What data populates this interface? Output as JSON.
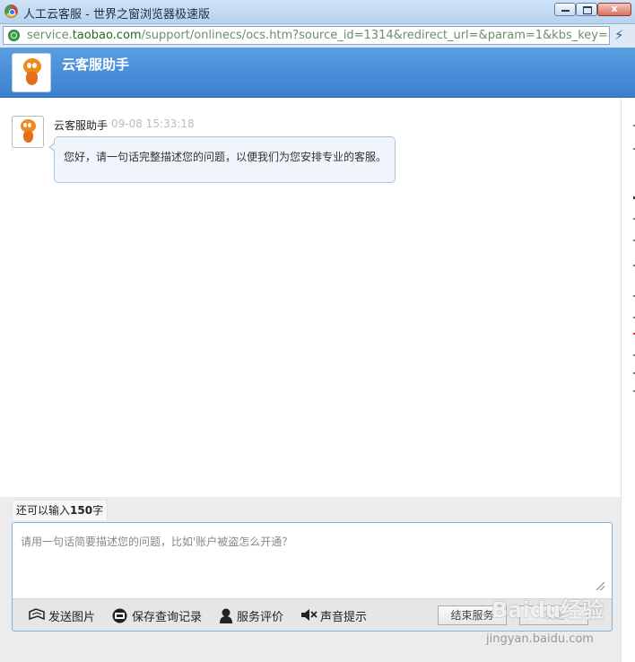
{
  "window": {
    "title": "人工云客服 - 世界之窗浏览器极速版",
    "close_label": "x"
  },
  "address_bar": {
    "url_prefix": "service.",
    "url_domain": "taobao.com",
    "url_rest": "/support/onlinecs/ocs.htm?source_id=1314&redirect_url=&param=1&kbs_key=&out_token=",
    "bolt_icon": "⚡"
  },
  "header": {
    "assistant_name": "云客服助手"
  },
  "conversation": {
    "messages": [
      {
        "sender": "云客服助手",
        "time": "09-08 15:33:18",
        "text": "您好，请一句话完整描述您的问题，以便我们为您安排专业的客服。"
      }
    ]
  },
  "composer": {
    "counter_prefix": "还可以输入",
    "counter_value": "150",
    "counter_suffix": "字",
    "placeholder": "请用一句话简要描述您的问题，比如'账户被盗怎么开通？",
    "tools": {
      "send_image": "发送图片",
      "save_history": "保存查询记录",
      "rate_service": "服务评价",
      "sound_alert": "声音提示"
    },
    "end_service_label": "结束服务",
    "send_label": "发送"
  },
  "watermark": {
    "logo": "Baidu经验",
    "url": "jingyan.baidu.com"
  },
  "colors": {
    "header_blue": "#3a80cf",
    "mascot_orange": "#f08a1c",
    "input_border": "#7fb3e3"
  }
}
